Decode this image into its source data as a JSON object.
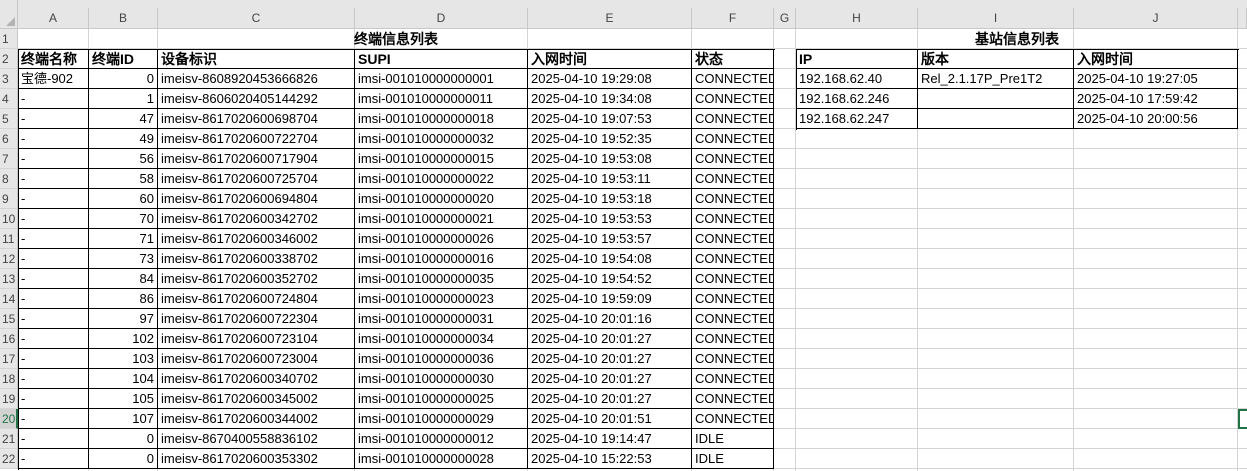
{
  "columns": [
    "A",
    "B",
    "C",
    "D",
    "E",
    "F",
    "G",
    "H",
    "I",
    "J"
  ],
  "rows": [
    "1",
    "2",
    "3",
    "4",
    "5",
    "6",
    "7",
    "8",
    "9",
    "10",
    "11",
    "12",
    "13",
    "14",
    "15",
    "16",
    "17",
    "18",
    "19",
    "20",
    "21",
    "22"
  ],
  "selected_row": "20",
  "terminal_table": {
    "title": "终端信息列表",
    "headers": [
      "终端名称",
      "终端ID",
      "设备标识",
      "SUPI",
      "入网时间",
      "状态"
    ],
    "rows": [
      [
        "宝德-902",
        "0",
        "imeisv-8608920453666826",
        "imsi-001010000000001",
        "2025-04-10 19:29:08",
        "CONNECTED"
      ],
      [
        "-",
        "1",
        "imeisv-8606020405144292",
        "imsi-001010000000011",
        "2025-04-10 19:34:08",
        "CONNECTED"
      ],
      [
        "-",
        "47",
        "imeisv-8617020600698704",
        "imsi-001010000000018",
        "2025-04-10 19:07:53",
        "CONNECTED"
      ],
      [
        "-",
        "49",
        "imeisv-8617020600722704",
        "imsi-001010000000032",
        "2025-04-10 19:52:35",
        "CONNECTED"
      ],
      [
        "-",
        "56",
        "imeisv-8617020600717904",
        "imsi-001010000000015",
        "2025-04-10 19:53:08",
        "CONNECTED"
      ],
      [
        "-",
        "58",
        "imeisv-8617020600725704",
        "imsi-001010000000022",
        "2025-04-10 19:53:11",
        "CONNECTED"
      ],
      [
        "-",
        "60",
        "imeisv-8617020600694804",
        "imsi-001010000000020",
        "2025-04-10 19:53:18",
        "CONNECTED"
      ],
      [
        "-",
        "70",
        "imeisv-8617020600342702",
        "imsi-001010000000021",
        "2025-04-10 19:53:53",
        "CONNECTED"
      ],
      [
        "-",
        "71",
        "imeisv-8617020600346002",
        "imsi-001010000000026",
        "2025-04-10 19:53:57",
        "CONNECTED"
      ],
      [
        "-",
        "73",
        "imeisv-8617020600338702",
        "imsi-001010000000016",
        "2025-04-10 19:54:08",
        "CONNECTED"
      ],
      [
        "-",
        "84",
        "imeisv-8617020600352702",
        "imsi-001010000000035",
        "2025-04-10 19:54:52",
        "CONNECTED"
      ],
      [
        "-",
        "86",
        "imeisv-8617020600724804",
        "imsi-001010000000023",
        "2025-04-10 19:59:09",
        "CONNECTED"
      ],
      [
        "-",
        "97",
        "imeisv-8617020600722304",
        "imsi-001010000000031",
        "2025-04-10 20:01:16",
        "CONNECTED"
      ],
      [
        "-",
        "102",
        "imeisv-8617020600723104",
        "imsi-001010000000034",
        "2025-04-10 20:01:27",
        "CONNECTED"
      ],
      [
        "-",
        "103",
        "imeisv-8617020600723004",
        "imsi-001010000000036",
        "2025-04-10 20:01:27",
        "CONNECTED"
      ],
      [
        "-",
        "104",
        "imeisv-8617020600340702",
        "imsi-001010000000030",
        "2025-04-10 20:01:27",
        "CONNECTED"
      ],
      [
        "-",
        "105",
        "imeisv-8617020600345002",
        "imsi-001010000000025",
        "2025-04-10 20:01:27",
        "CONNECTED"
      ],
      [
        "-",
        "107",
        "imeisv-8617020600344002",
        "imsi-001010000000029",
        "2025-04-10 20:01:51",
        "CONNECTED"
      ],
      [
        "-",
        "0",
        "imeisv-8670400558836102",
        "imsi-001010000000012",
        "2025-04-10 19:14:47",
        "IDLE"
      ],
      [
        "-",
        "0",
        "imeisv-8617020600353302",
        "imsi-001010000000028",
        "2025-04-10 15:22:53",
        "IDLE"
      ]
    ]
  },
  "station_table": {
    "title": "基站信息列表",
    "headers": [
      "IP",
      "版本",
      "入网时间"
    ],
    "rows": [
      [
        "192.168.62.40",
        "Rel_2.1.17P_Pre1T2",
        "2025-04-10 19:27:05"
      ],
      [
        "192.168.62.246",
        "",
        "2025-04-10 17:59:42"
      ],
      [
        "192.168.62.247",
        "",
        "2025-04-10 20:00:56"
      ]
    ]
  }
}
